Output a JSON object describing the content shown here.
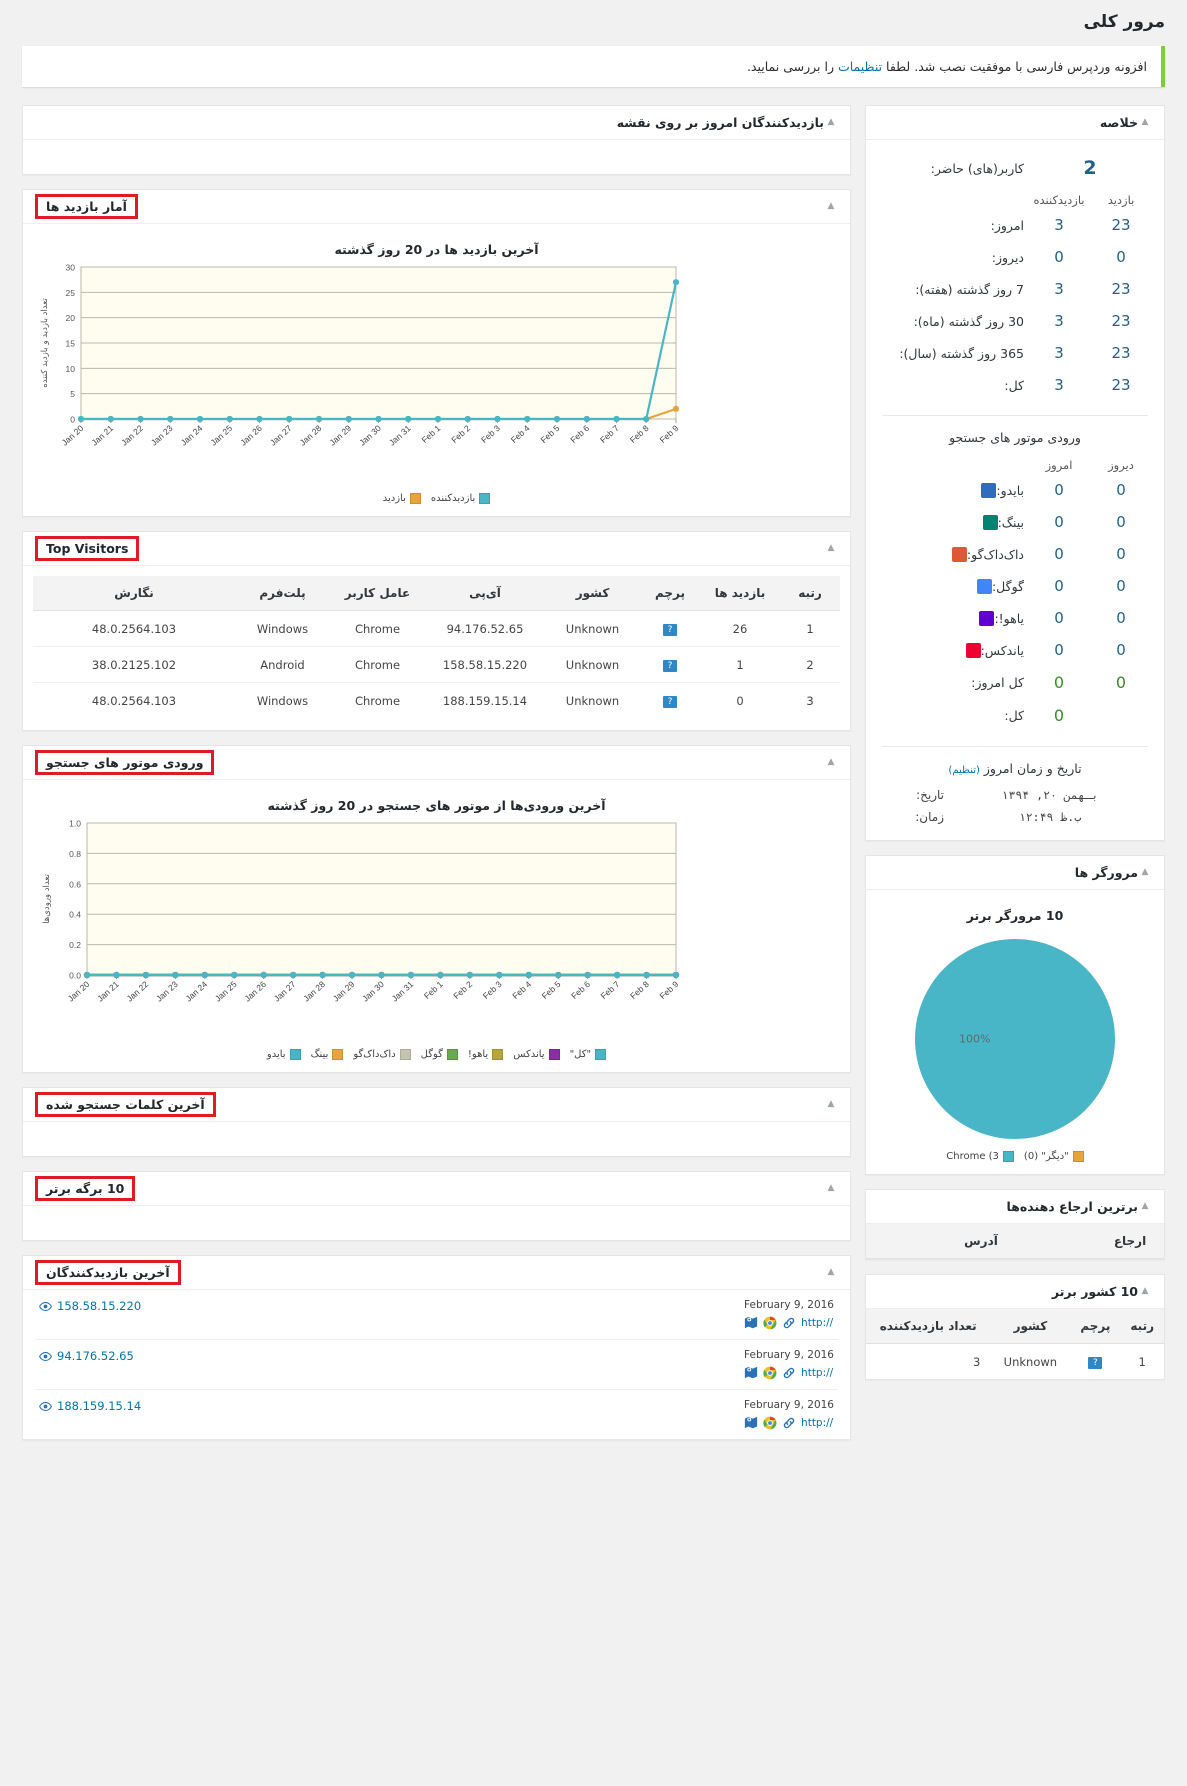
{
  "page": {
    "title": "مرور کلی",
    "notice_before": "افزونه وردپرس فارسی با موفقیت نصب شد. لطفا ",
    "notice_link": "تنظیمات",
    "notice_after": " را بررسی نمایید."
  },
  "summary": {
    "title": "خلاصه",
    "online_label": "کاربر(های) حاضر:",
    "online_value": "2",
    "col_visitor": "بازدیدکننده",
    "col_visit": "بازدید",
    "rows": [
      {
        "label": "امروز:",
        "visitor": "3",
        "visit": "23"
      },
      {
        "label": "دیروز:",
        "visitor": "0",
        "visit": "0"
      },
      {
        "label": "7 روز گذشته (هفته):",
        "visitor": "3",
        "visit": "23"
      },
      {
        "label": "30 روز گذشته (ماه):",
        "visitor": "3",
        "visit": "23"
      },
      {
        "label": "365 روز گذشته (سال):",
        "visitor": "3",
        "visit": "23"
      },
      {
        "label": "کل:",
        "visitor": "3",
        "visit": "23"
      }
    ],
    "se_title": "ورودی موتور های جستجو",
    "se_col_today": "امروز",
    "se_col_yesterday": "دیروز",
    "se_rows": [
      {
        "label": "بایدو:",
        "icon": "baidu-icon",
        "color": "#2d6cbf",
        "today": "0",
        "yesterday": "0"
      },
      {
        "label": "بینگ:",
        "icon": "bing-icon",
        "color": "#008373",
        "today": "0",
        "yesterday": "0"
      },
      {
        "label": "داک‌داک‌گو:",
        "icon": "duckduckgo-icon",
        "color": "#de5833",
        "today": "0",
        "yesterday": "0"
      },
      {
        "label": "گوگل:",
        "icon": "google-icon",
        "color": "#4285f4",
        "today": "0",
        "yesterday": "0"
      },
      {
        "label": "یاهو!:",
        "icon": "yahoo-icon",
        "color": "#6001d2",
        "today": "0",
        "yesterday": "0"
      },
      {
        "label": "یاندکس:",
        "icon": "yandex-icon",
        "color": "#e03",
        "today": "0",
        "yesterday": "0"
      }
    ],
    "se_total_today_label": "کل امروز:",
    "se_total_today": "0",
    "se_total_today_yesterday": "0",
    "se_total_label": "کل:",
    "se_total": "0",
    "datetime_title": "تاریخ و زمان امروز",
    "datetime_settings_link": "(تنظیم)",
    "date_label": "تاریخ:",
    "date_value": "بـهمن ۲۰, ۱۳۹۴",
    "time_label": "زمان:",
    "time_value": "ب.ظ ۱۲:۴۹"
  },
  "map_box": {
    "title": "بازدیدکنندگان امروز بر روی نقشه"
  },
  "hits_box": {
    "title": "آمار بازدید ها"
  },
  "top_visitors": {
    "title": "Top Visitors",
    "columns": [
      "رتبه",
      "بازدید ها",
      "پرچم",
      "کشور",
      "آی‌پی",
      "عامل کاربر",
      "پلت‌فرم",
      "نگارش"
    ],
    "rows": [
      {
        "rank": "1",
        "hits": "26",
        "flag": "?",
        "country": "Unknown",
        "ip": "94.176.52.65",
        "agent": "Chrome",
        "platform": "Windows",
        "version": "48.0.2564.103"
      },
      {
        "rank": "2",
        "hits": "1",
        "flag": "?",
        "country": "Unknown",
        "ip": "158.58.15.220",
        "agent": "Chrome",
        "platform": "Android",
        "version": "38.0.2125.102"
      },
      {
        "rank": "3",
        "hits": "0",
        "flag": "?",
        "country": "Unknown",
        "ip": "188.159.15.14",
        "agent": "Chrome",
        "platform": "Windows",
        "version": "48.0.2564.103"
      }
    ]
  },
  "search_box": {
    "title": "ورودی موتور های جستجو"
  },
  "words_box": {
    "title": "آخرین کلمات جستجو شده"
  },
  "pages_box": {
    "title": "10 برگه برتر"
  },
  "last_visitors": {
    "title": "آخرین بازدیدکنندگان",
    "rows": [
      {
        "date": "February 9, 2016",
        "ip": "158.58.15.220",
        "link": "http://"
      },
      {
        "date": "February 9, 2016",
        "ip": "94.176.52.65",
        "link": "http://"
      },
      {
        "date": "February 9, 2016",
        "ip": "188.159.15.14",
        "link": "http://"
      }
    ]
  },
  "browsers_box": {
    "title": "مرورگر ها"
  },
  "referrers_box": {
    "title": "برترین ارجاع دهنده‌ها",
    "columns": [
      "ارجاع",
      "آدرس"
    ]
  },
  "countries_box": {
    "title": "10 کشور برتر",
    "columns": [
      "رتبه",
      "پرچم",
      "کشور",
      "تعداد بازدیدکننده"
    ],
    "rows": [
      {
        "rank": "1",
        "flag": "?",
        "country": "Unknown",
        "visitors": "3"
      }
    ]
  },
  "colors": {
    "visit": "#e8a33d",
    "visitor": "#49b6c8",
    "search_total": "#a6318a",
    "accent": "#0073aa",
    "highlight_border": "#e01b24"
  },
  "chart_data": [
    {
      "type": "line",
      "id": "hits-chart",
      "title": "آخرین بازدید ها در 20 روز گذشته",
      "ylabel": "تعداد بازدید و بازدید کننده",
      "xlabel": "",
      "ylim": [
        0,
        30
      ],
      "yticks": [
        0,
        5,
        10,
        15,
        20,
        25,
        30
      ],
      "grid": true,
      "legend_position": "bottom",
      "categories": [
        "Jan 20",
        "Jan 21",
        "Jan 22",
        "Jan 23",
        "Jan 24",
        "Jan 25",
        "Jan 26",
        "Jan 27",
        "Jan 28",
        "Jan 29",
        "Jan 30",
        "Jan 31",
        "Feb 1",
        "Feb 2",
        "Feb 3",
        "Feb 4",
        "Feb 5",
        "Feb 6",
        "Feb 7",
        "Feb 8",
        "Feb 9"
      ],
      "series": [
        {
          "name": "بازدید",
          "color": "#e8a33d",
          "values": [
            0,
            0,
            0,
            0,
            0,
            0,
            0,
            0,
            0,
            0,
            0,
            0,
            0,
            0,
            0,
            0,
            0,
            0,
            0,
            0,
            2
          ]
        },
        {
          "name": "بازدیدکننده",
          "color": "#49b6c8",
          "values": [
            0,
            0,
            0,
            0,
            0,
            0,
            0,
            0,
            0,
            0,
            0,
            0,
            0,
            0,
            0,
            0,
            0,
            0,
            0,
            0,
            27
          ]
        }
      ]
    },
    {
      "type": "line",
      "id": "search-chart",
      "title": "آخرین ورودی‌ها از موتور های جستجو در 20 روز گذشته",
      "ylabel": "تعداد ورودی‌ها",
      "xlabel": "",
      "ylim": [
        0,
        1
      ],
      "yticks": [
        "0.0",
        "0.2",
        "0.4",
        "0.6",
        "0.8",
        "1.0"
      ],
      "grid": true,
      "legend_position": "bottom",
      "categories": [
        "Jan 20",
        "Jan 21",
        "Jan 22",
        "Jan 23",
        "Jan 24",
        "Jan 25",
        "Jan 26",
        "Jan 27",
        "Jan 28",
        "Jan 29",
        "Jan 30",
        "Jan 31",
        "Feb 1",
        "Feb 2",
        "Feb 3",
        "Feb 4",
        "Feb 5",
        "Feb 6",
        "Feb 7",
        "Feb 8",
        "Feb 9"
      ],
      "series": [
        {
          "name": "بایدو",
          "color": "#49b6c8",
          "values": [
            0,
            0,
            0,
            0,
            0,
            0,
            0,
            0,
            0,
            0,
            0,
            0,
            0,
            0,
            0,
            0,
            0,
            0,
            0,
            0,
            0
          ]
        },
        {
          "name": "بینگ",
          "color": "#e8a33d",
          "values": [
            0,
            0,
            0,
            0,
            0,
            0,
            0,
            0,
            0,
            0,
            0,
            0,
            0,
            0,
            0,
            0,
            0,
            0,
            0,
            0,
            0
          ]
        },
        {
          "name": "داک‌داک‌گو",
          "color": "#c4c4b0",
          "values": [
            0,
            0,
            0,
            0,
            0,
            0,
            0,
            0,
            0,
            0,
            0,
            0,
            0,
            0,
            0,
            0,
            0,
            0,
            0,
            0,
            0
          ]
        },
        {
          "name": "گوگل",
          "color": "#6aa84f",
          "values": [
            0,
            0,
            0,
            0,
            0,
            0,
            0,
            0,
            0,
            0,
            0,
            0,
            0,
            0,
            0,
            0,
            0,
            0,
            0,
            0,
            0
          ]
        },
        {
          "name": "یاهو!",
          "color": "#b8a43a",
          "values": [
            0,
            0,
            0,
            0,
            0,
            0,
            0,
            0,
            0,
            0,
            0,
            0,
            0,
            0,
            0,
            0,
            0,
            0,
            0,
            0,
            0
          ]
        },
        {
          "name": "یاندکس",
          "color": "#8a2ea8",
          "values": [
            0,
            0,
            0,
            0,
            0,
            0,
            0,
            0,
            0,
            0,
            0,
            0,
            0,
            0,
            0,
            0,
            0,
            0,
            0,
            0,
            0
          ]
        },
        {
          "name": "\"کل\"",
          "color": "#49b6c8",
          "values": [
            0,
            0,
            0,
            0,
            0,
            0,
            0,
            0,
            0,
            0,
            0,
            0,
            0,
            0,
            0,
            0,
            0,
            0,
            0,
            0,
            0
          ]
        }
      ]
    },
    {
      "type": "pie",
      "id": "browser-pie",
      "title": "10 مرورگر برتر",
      "slices": [
        {
          "label": "Chrome (3",
          "value": 100,
          "color": "#49b6c8",
          "display": "100%"
        },
        {
          "label": "\"دیگر\" (0)",
          "value": 0,
          "color": "#e8a33d",
          "display": ""
        }
      ]
    }
  ]
}
